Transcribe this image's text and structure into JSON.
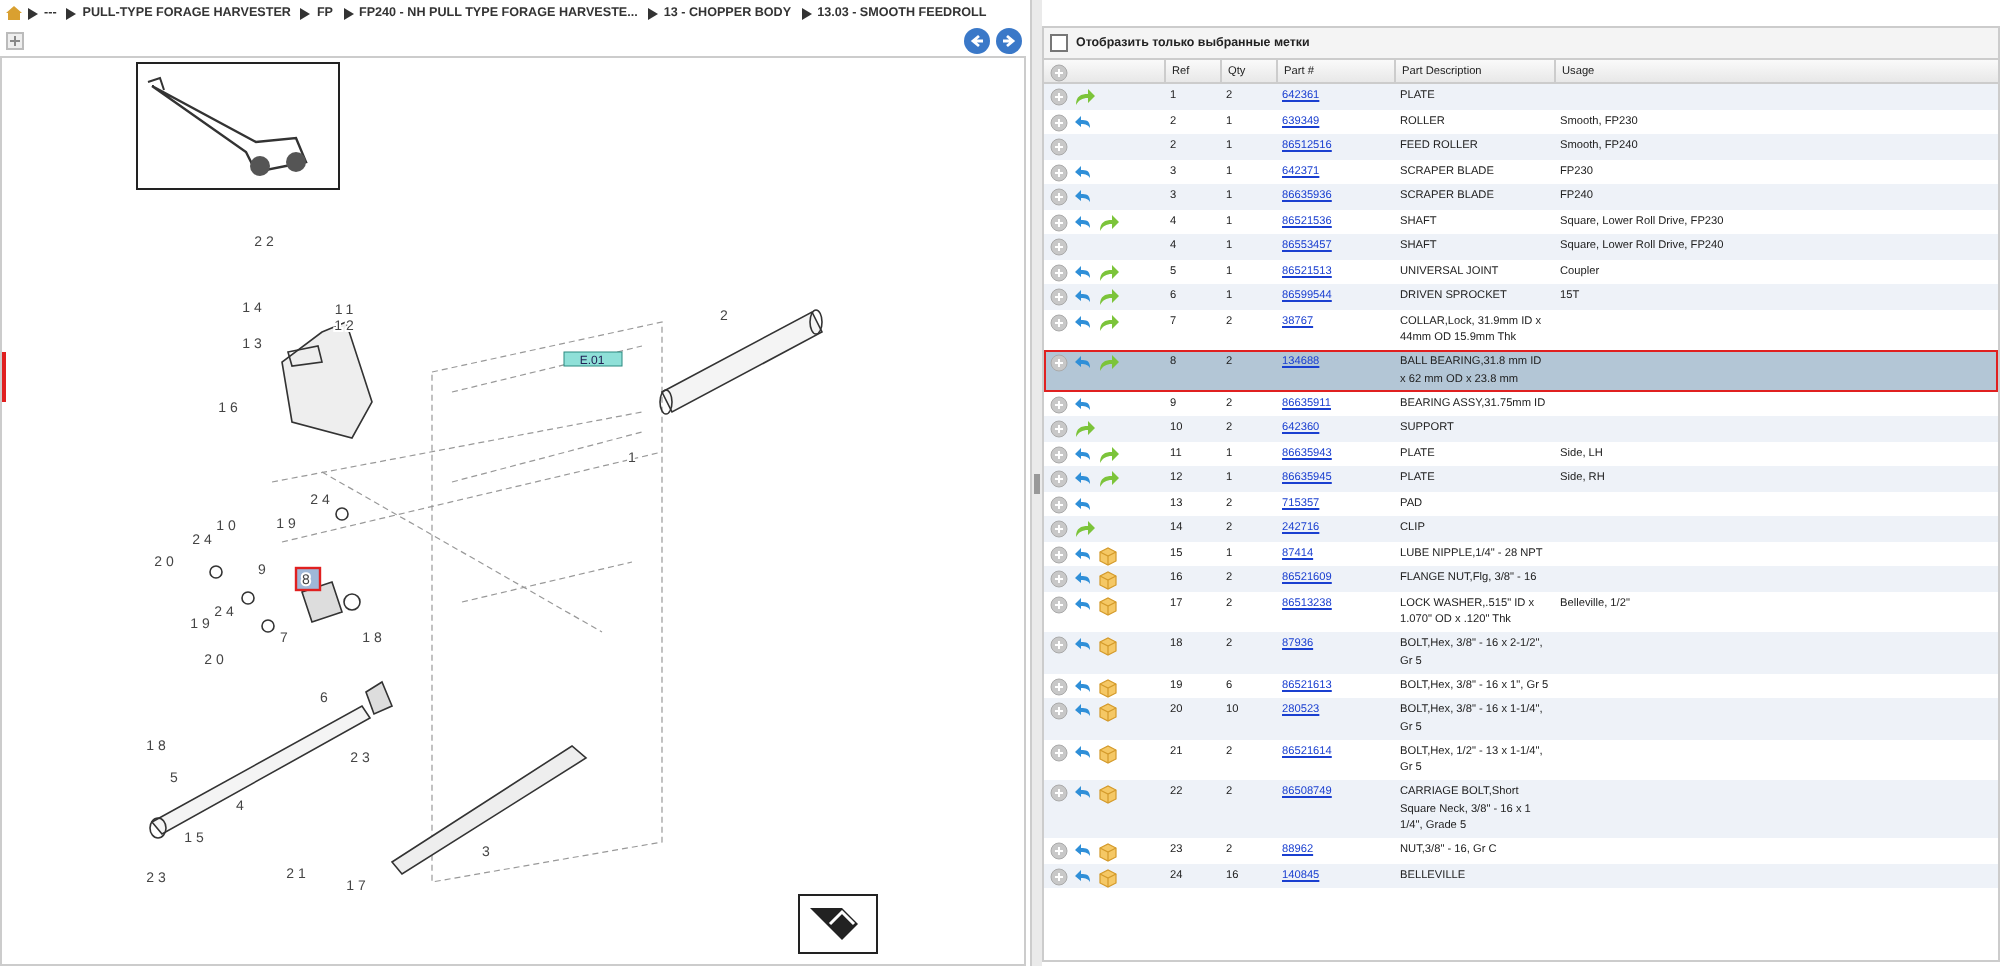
{
  "breadcrumb": [
    "---",
    "PULL-TYPE FORAGE HARVESTER",
    "FP",
    "FP240 - NH PULL TYPE FORAGE HARVESTE...",
    "13 - CHOPPER BODY",
    "13.03 - SMOOTH FEEDROLL"
  ],
  "diagram": {
    "sheet_label": "E.01",
    "callouts": [
      {
        "label": "22",
        "selected": false
      },
      {
        "label": "14",
        "selected": false
      },
      {
        "label": "11",
        "selected": false
      },
      {
        "label": "12",
        "selected": false
      },
      {
        "label": "13",
        "selected": false
      },
      {
        "label": "16",
        "selected": false
      },
      {
        "label": "2",
        "selected": false
      },
      {
        "label": "1",
        "selected": false
      },
      {
        "label": "24",
        "selected": false
      },
      {
        "label": "19",
        "selected": false
      },
      {
        "label": "10",
        "selected": false
      },
      {
        "label": "24",
        "selected": false
      },
      {
        "label": "20",
        "selected": false
      },
      {
        "label": "9",
        "selected": false
      },
      {
        "label": "8",
        "selected": true
      },
      {
        "label": "19",
        "selected": false
      },
      {
        "label": "24",
        "selected": false
      },
      {
        "label": "7",
        "selected": false
      },
      {
        "label": "20",
        "selected": false
      },
      {
        "label": "18",
        "selected": false
      },
      {
        "label": "6",
        "selected": false
      },
      {
        "label": "23",
        "selected": false
      },
      {
        "label": "18",
        "selected": false
      },
      {
        "label": "5",
        "selected": false
      },
      {
        "label": "4",
        "selected": false
      },
      {
        "label": "15",
        "selected": false
      },
      {
        "label": "23",
        "selected": false
      },
      {
        "label": "21",
        "selected": false
      },
      {
        "label": "17",
        "selected": false
      },
      {
        "label": "3",
        "selected": false
      }
    ]
  },
  "filter": {
    "label": "Отобразить только выбранные метки",
    "checked": false
  },
  "parts": {
    "columns": [
      "Ref",
      "Qty",
      "Part #",
      "Part Description",
      "Usage"
    ],
    "rows": [
      {
        "ref": "1",
        "qty": "2",
        "part": "642361",
        "description": "PLATE",
        "usage": "",
        "back": false,
        "forward": true,
        "box": false,
        "selected": false
      },
      {
        "ref": "2",
        "qty": "1",
        "part": "639349",
        "description": "ROLLER",
        "usage": "Smooth, FP230",
        "back": true,
        "forward": false,
        "box": false,
        "selected": false
      },
      {
        "ref": "2",
        "qty": "1",
        "part": "86512516",
        "description": "FEED ROLLER",
        "usage": "Smooth, FP240",
        "back": false,
        "forward": false,
        "box": false,
        "selected": false
      },
      {
        "ref": "3",
        "qty": "1",
        "part": "642371",
        "description": "SCRAPER BLADE",
        "usage": "FP230",
        "back": true,
        "forward": false,
        "box": false,
        "selected": false
      },
      {
        "ref": "3",
        "qty": "1",
        "part": "86635936",
        "description": "SCRAPER BLADE",
        "usage": "FP240",
        "back": true,
        "forward": false,
        "box": false,
        "selected": false
      },
      {
        "ref": "4",
        "qty": "1",
        "part": "86521536",
        "description": "SHAFT",
        "usage": "Square, Lower Roll Drive, FP230",
        "back": true,
        "forward": true,
        "box": false,
        "selected": false
      },
      {
        "ref": "4",
        "qty": "1",
        "part": "86553457",
        "description": "SHAFT",
        "usage": "Square, Lower Roll Drive, FP240",
        "back": false,
        "forward": false,
        "box": false,
        "selected": false
      },
      {
        "ref": "5",
        "qty": "1",
        "part": "86521513",
        "description": "UNIVERSAL JOINT",
        "usage": "Coupler",
        "back": true,
        "forward": true,
        "box": false,
        "selected": false
      },
      {
        "ref": "6",
        "qty": "1",
        "part": "86599544",
        "description": "DRIVEN SPROCKET",
        "usage": "15T",
        "back": true,
        "forward": true,
        "box": false,
        "selected": false
      },
      {
        "ref": "7",
        "qty": "2",
        "part": "38767",
        "description": "COLLAR,Lock, 31.9mm ID x 44mm OD 15.9mm Thk",
        "usage": "",
        "back": true,
        "forward": true,
        "box": false,
        "selected": false
      },
      {
        "ref": "8",
        "qty": "2",
        "part": "134688",
        "description": "BALL BEARING,31.8 mm ID x 62 mm OD x 23.8 mm",
        "usage": "",
        "back": true,
        "forward": true,
        "box": false,
        "selected": true
      },
      {
        "ref": "9",
        "qty": "2",
        "part": "86635911",
        "description": "BEARING ASSY,31.75mm ID",
        "usage": "",
        "back": true,
        "forward": false,
        "box": false,
        "selected": false
      },
      {
        "ref": "10",
        "qty": "2",
        "part": "642360",
        "description": "SUPPORT",
        "usage": "",
        "back": false,
        "forward": true,
        "box": false,
        "selected": false
      },
      {
        "ref": "11",
        "qty": "1",
        "part": "86635943",
        "description": "PLATE",
        "usage": "Side, LH",
        "back": true,
        "forward": true,
        "box": false,
        "selected": false
      },
      {
        "ref": "12",
        "qty": "1",
        "part": "86635945",
        "description": "PLATE",
        "usage": "Side, RH",
        "back": true,
        "forward": true,
        "box": false,
        "selected": false
      },
      {
        "ref": "13",
        "qty": "2",
        "part": "715357",
        "description": "PAD",
        "usage": "",
        "back": true,
        "forward": false,
        "box": false,
        "selected": false
      },
      {
        "ref": "14",
        "qty": "2",
        "part": "242716",
        "description": "CLIP",
        "usage": "",
        "back": false,
        "forward": true,
        "box": false,
        "selected": false
      },
      {
        "ref": "15",
        "qty": "1",
        "part": "87414",
        "description": "LUBE NIPPLE,1/4\" - 28 NPT",
        "usage": "",
        "back": true,
        "forward": false,
        "box": true,
        "selected": false
      },
      {
        "ref": "16",
        "qty": "2",
        "part": "86521609",
        "description": "FLANGE NUT,Flg, 3/8\" - 16",
        "usage": "",
        "back": true,
        "forward": false,
        "box": true,
        "selected": false
      },
      {
        "ref": "17",
        "qty": "2",
        "part": "86513238",
        "description": "LOCK WASHER,.515\" ID x 1.070\" OD x .120\" Thk",
        "usage": "Belleville, 1/2\"",
        "back": true,
        "forward": false,
        "box": true,
        "selected": false
      },
      {
        "ref": "18",
        "qty": "2",
        "part": "87936",
        "description": "BOLT,Hex, 3/8\" - 16 x 2-1/2\", Gr 5",
        "usage": "",
        "back": true,
        "forward": false,
        "box": true,
        "selected": false
      },
      {
        "ref": "19",
        "qty": "6",
        "part": "86521613",
        "description": "BOLT,Hex, 3/8\" - 16 x 1\", Gr 5",
        "usage": "",
        "back": true,
        "forward": false,
        "box": true,
        "selected": false
      },
      {
        "ref": "20",
        "qty": "10",
        "part": "280523",
        "description": "BOLT,Hex, 3/8\" - 16 x 1-1/4\", Gr 5",
        "usage": "",
        "back": true,
        "forward": false,
        "box": true,
        "selected": false
      },
      {
        "ref": "21",
        "qty": "2",
        "part": "86521614",
        "description": "BOLT,Hex, 1/2\" - 13 x 1-1/4\", Gr 5",
        "usage": "",
        "back": true,
        "forward": false,
        "box": true,
        "selected": false
      },
      {
        "ref": "22",
        "qty": "2",
        "part": "86508749",
        "description": "CARRIAGE BOLT,Short Square Neck, 3/8\" - 16 x 1 1/4\", Grade 5",
        "usage": "",
        "back": true,
        "forward": false,
        "box": true,
        "selected": false
      },
      {
        "ref": "23",
        "qty": "2",
        "part": "88962",
        "description": "NUT,3/8\" - 16, Gr C",
        "usage": "",
        "back": true,
        "forward": false,
        "box": true,
        "selected": false
      },
      {
        "ref": "24",
        "qty": "16",
        "part": "140845",
        "description": "BELLEVILLE",
        "usage": "",
        "back": true,
        "forward": false,
        "box": true,
        "selected": false
      }
    ]
  }
}
